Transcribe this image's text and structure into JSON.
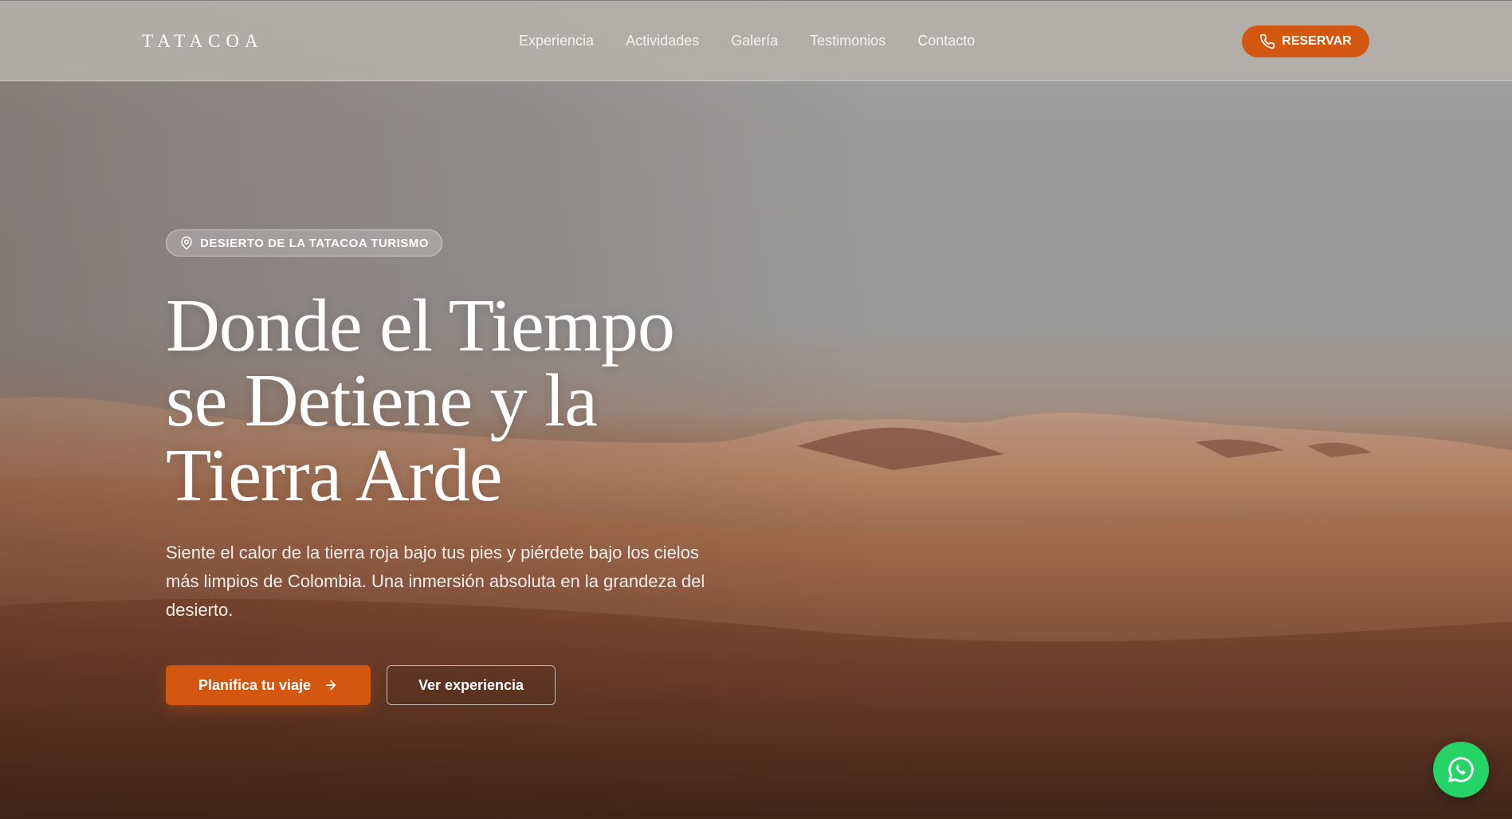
{
  "header": {
    "logo": "TATACOA",
    "nav": [
      {
        "label": "Experiencia"
      },
      {
        "label": "Actividades"
      },
      {
        "label": "Galería"
      },
      {
        "label": "Testimonios"
      },
      {
        "label": "Contacto"
      }
    ],
    "reserve_label": "RESERVAR",
    "reserve_icon": "phone-icon"
  },
  "hero": {
    "badge_icon": "map-pin-icon",
    "badge": "DESIERTO DE LA TATACOA TURISMO",
    "title_lines": [
      "Donde el Tiempo",
      "se Detiene y la",
      "Tierra Arde"
    ],
    "description": "Siente el calor de la tierra roja bajo tus pies y piérdete bajo los cielos más limpios de Colombia. Una inmersión absoluta en la grandeza del desierto.",
    "primary_cta": "Planifica tu viaje",
    "primary_cta_icon": "arrow-right-icon",
    "secondary_cta": "Ver experiencia"
  },
  "floating": {
    "whatsapp_icon": "whatsapp-icon"
  },
  "colors": {
    "accent": "#d4570f",
    "whatsapp": "#25d366",
    "header_bg": "#b4b0ac"
  }
}
